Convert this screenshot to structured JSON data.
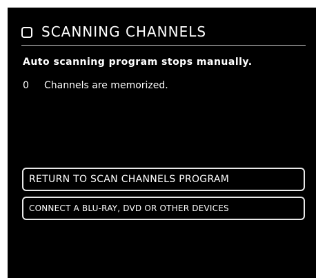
{
  "window": {
    "title": "SCANNING CHANNELS",
    "icon": "checkbox-icon"
  },
  "status": {
    "message": "Auto scanning program stops manually.",
    "channels_count": "0",
    "channels_text": "Channels are memorized."
  },
  "actions": {
    "return_label": "RETURN TO SCAN CHANNELS PROGRAM",
    "connect_label": "CONNECT A BLU-RAY, DVD OR OTHER DEVICES"
  },
  "colors": {
    "background": "#000000",
    "text": "#ffffff",
    "border": "#e8e8e8"
  }
}
